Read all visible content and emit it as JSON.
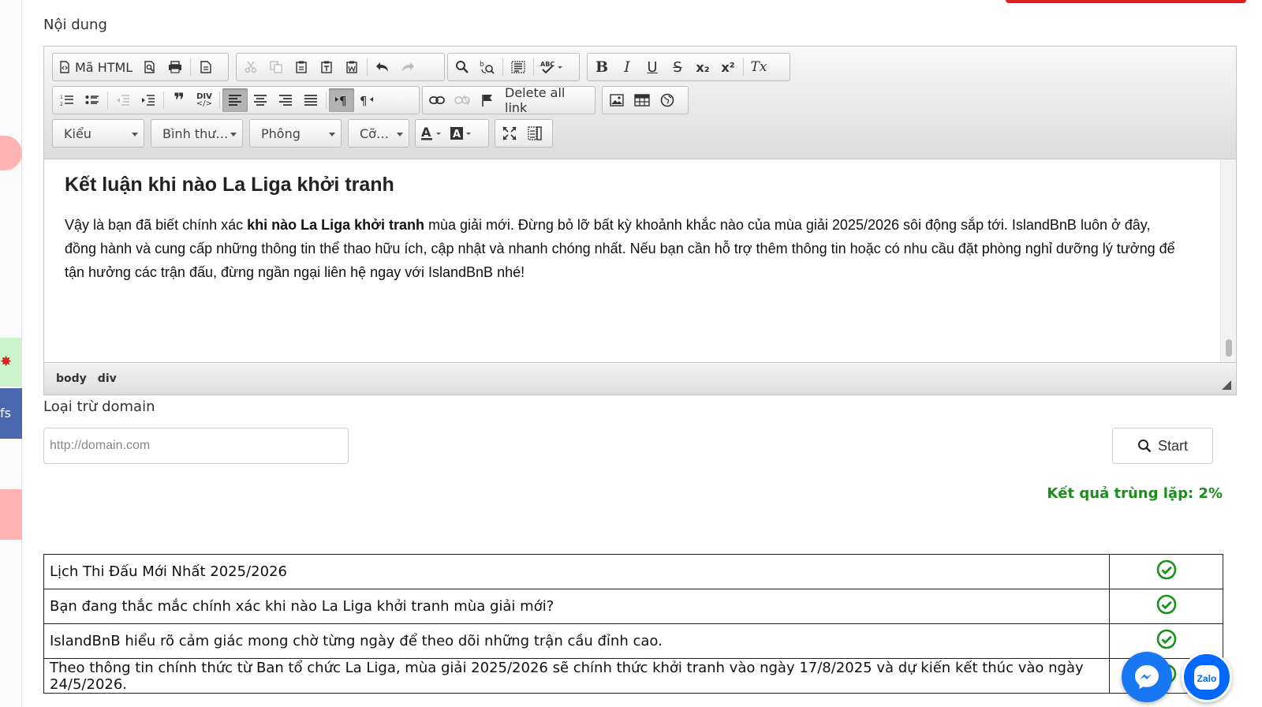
{
  "colors": {
    "accent_red": "#e02020",
    "check_green": "#1a8f1a",
    "messenger_blue": "#1877f2",
    "zalo_blue": "#0068ff",
    "side_pink": "#ffb3b3",
    "side_green": "#cdf3cd",
    "side_blue": "#4a67b0"
  },
  "side_tabs": {
    "fb_label": "fs"
  },
  "content_label": "Nội dung",
  "toolbar": {
    "source_label": "Mã HTML",
    "delete_links_label": "Delete all link",
    "style_combo": "Kiểu",
    "format_combo": "Bình thư…",
    "font_combo": "Phông",
    "size_combo": "Cỡ…",
    "bold": "B",
    "italic": "I",
    "underline": "U",
    "strike": "S",
    "subscript": "x₂",
    "superscript": "x²",
    "remove_format": "Tx",
    "blockquote": "❞",
    "div": "DIV",
    "icons_row1": [
      "source-icon",
      "preview-icon",
      "print-icon",
      "templates-icon",
      "cut-icon",
      "copy-icon",
      "paste-icon",
      "paste-text-icon",
      "paste-word-icon",
      "undo-icon",
      "redo-icon",
      "find-icon",
      "replace-icon",
      "select-all-icon",
      "spellcheck-icon"
    ],
    "icons_row2": [
      "numbered-list-icon",
      "bulleted-list-icon",
      "outdent-icon",
      "indent-icon",
      "blockquote-icon",
      "div-icon",
      "align-left-icon",
      "align-center-icon",
      "align-right-icon",
      "justify-icon",
      "ltr-icon",
      "rtl-icon",
      "link-icon",
      "unlink-icon",
      "anchor-icon",
      "image-icon",
      "table-icon",
      "iframe-icon"
    ],
    "icons_row3": [
      "text-color-icon",
      "bg-color-icon",
      "maximize-icon",
      "show-blocks-icon"
    ]
  },
  "editor": {
    "heading": "Kết luận khi nào La Liga khởi tranh",
    "para_before": "Vậy là bạn đã biết chính xác ",
    "para_bold": "khi nào La Liga khởi tranh",
    "para_after": " mùa giải mới. Đừng bỏ lỡ bất kỳ khoảnh khắc nào của mùa giải 2025/2026 sôi động sắp tới. IslandBnB luôn ở đây, đồng hành và cung cấp những thông tin thể thao hữu ích, cập nhật và nhanh chóng nhất. Nếu bạn cần hỗ trợ thêm thông tin hoặc có nhu cầu đặt phòng nghỉ dưỡng lý tưởng để tận hưởng các trận đấu, đừng ngần ngại liên hệ ngay với IslandBnB nhé!",
    "status_path": [
      "body",
      "div"
    ]
  },
  "exclude_label": "Loại trừ domain",
  "domain_placeholder": "http://domain.com",
  "start_label": "Start",
  "result_text": "Kết quả trùng lặp: 2%",
  "rows": [
    "Lịch Thi Đấu Mới Nhất 2025/2026",
    "Bạn đang thắc mắc chính xác khi nào La Liga khởi tranh mùa giải mới?",
    "IslandBnB hiểu rõ cảm giác mong chờ từng ngày để theo dõi những trận cầu đỉnh cao.",
    "Theo thông tin chính thức từ Ban tổ chức La Liga, mùa giải 2025/2026 sẽ chính thức khởi tranh vào ngày 17/8/2025 và dự kiến kết thúc vào ngày 24/5/2026."
  ],
  "chat": {
    "zalo_label": "Zalo"
  }
}
